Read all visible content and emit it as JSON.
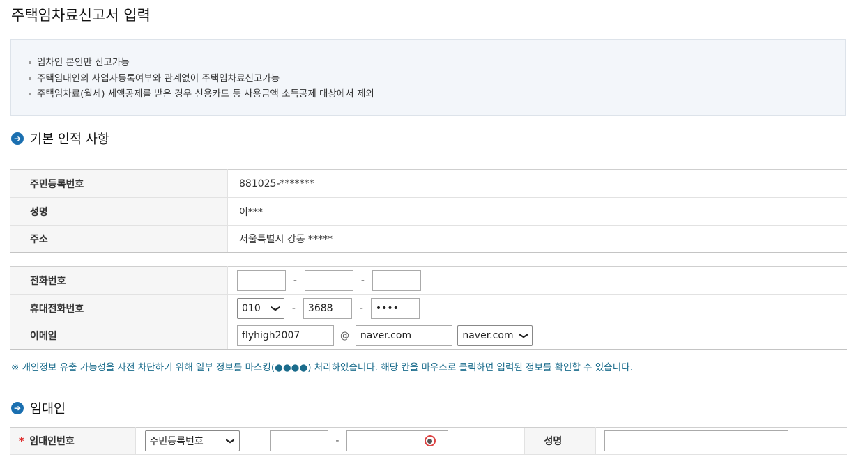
{
  "page_title": "주택임차료신고서 입력",
  "notices": [
    "임차인 본인만 신고가능",
    "주택임대인의 사업자등록여부와 관계없이 주택임차료신고가능",
    "주택임차료(월세) 세액공제를 받은 경우 신용카드 등 사용금액 소득공제 대상에서 제외"
  ],
  "basic_section": {
    "title": "기본 인적 사항",
    "rrn_label": "주민등록번호",
    "rrn_value": "881025-*******",
    "name_label": "성명",
    "name_value": "이***",
    "address_label": "주소",
    "address_value": "서울특별시 강동 *****"
  },
  "contact": {
    "phone_label": "전화번호",
    "phone_parts": [
      "",
      "",
      ""
    ],
    "mobile_label": "휴대전화번호",
    "mobile_prefix": "010",
    "mobile_middle": "3688",
    "mobile_last": "••••",
    "email_label": "이메일",
    "email_id": "flyhigh2007",
    "email_at": "@",
    "email_domain": "naver.com",
    "email_domain_select": "naver.com",
    "dash": "-"
  },
  "mask_note": "※ 개인정보 유출 가능성을 사전 차단하기 위해 일부 정보를 마스킹(●●●●) 처리하였습니다. 해당 칸을 마우스로 클릭하면 입력된 정보를 확인할 수 있습니다.",
  "lessor_section": {
    "title": "임대인",
    "id_label": "임대인번호",
    "required_mark": "*",
    "id_type_select": "주민등록번호",
    "id_part1": "",
    "id_part2": "",
    "name_label": "성명",
    "name_value": ""
  },
  "section_icon": "➔",
  "chevron": "❯"
}
